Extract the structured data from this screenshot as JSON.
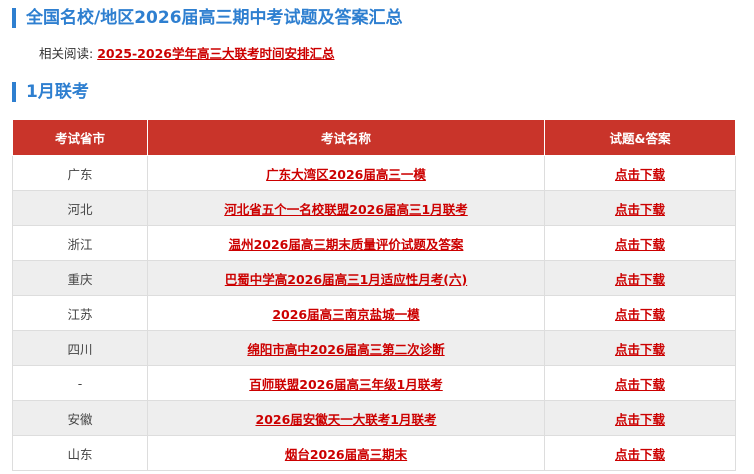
{
  "page_title": "全国名校/地区2026届高三期中考试题及答案汇总",
  "related": {
    "label": "相关阅读:",
    "link_text": "2025-2026学年高三大联考时间安排汇总"
  },
  "section_title": "1月联考",
  "table": {
    "headers": [
      "考试省市",
      "考试名称",
      "试题&答案"
    ],
    "rows": [
      {
        "province": "广东",
        "name": "广东大湾区2026届高三一模",
        "download": "点击下载"
      },
      {
        "province": "河北",
        "name": "河北省五个一名校联盟2026届高三1月联考",
        "download": "点击下载"
      },
      {
        "province": "浙江",
        "name": "温州2026届高三期末质量评价试题及答案",
        "download": "点击下载"
      },
      {
        "province": "重庆",
        "name": "巴蜀中学高2026届高三1月适应性月考(六)",
        "download": "点击下载"
      },
      {
        "province": "江苏",
        "name": "2026届高三南京盐城一模",
        "download": "点击下载"
      },
      {
        "province": "四川",
        "name": "绵阳市高中2026届高三第二次诊断",
        "download": "点击下载"
      },
      {
        "province": "-",
        "name": "百师联盟2026届高三年级1月联考",
        "download": "点击下载"
      },
      {
        "province": "安徽",
        "name": "2026届安徽天一大联考1月联考",
        "download": "点击下载"
      },
      {
        "province": "山东",
        "name": "烟台2026届高三期末",
        "download": "点击下载"
      }
    ]
  },
  "colors": {
    "heading": "#2e7fd0",
    "table_header": "#c9342a",
    "link": "#cc0000",
    "row_alt": "#eeeeee"
  }
}
